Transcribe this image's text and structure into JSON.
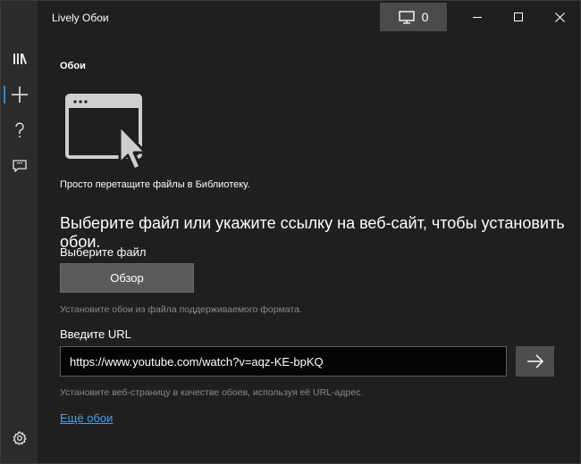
{
  "app": {
    "title": "Lively Обои"
  },
  "titlebar": {
    "monitor_count": "0"
  },
  "sidebar": {
    "items": [
      {
        "name": "library",
        "icon": "library-icon"
      },
      {
        "name": "add",
        "icon": "plus-icon",
        "active": true
      },
      {
        "name": "help",
        "icon": "question-icon"
      },
      {
        "name": "feedback",
        "icon": "feedback-icon"
      }
    ],
    "settings_icon": "gear-icon"
  },
  "main": {
    "section_title": "Обои",
    "drop_hint": "Просто перетащите файлы в Библиотеку.",
    "heading": "Выберите файл или укажите ссылку на веб-сайт, чтобы установить обои.",
    "file": {
      "label": "Выберите файл",
      "button": "Обзор",
      "help": "Установите обои из файла поддерживаемого формата."
    },
    "url": {
      "label": "Введите URL",
      "value": "https://www.youtube.com/watch?v=aqz-KE-bpKQ",
      "help": "Установите веб-страницу в качестве обоев, используя её URL-адрес."
    },
    "more_link": "Ещё обои"
  },
  "colors": {
    "accent": "#2a88d8",
    "link": "#4a9ee8",
    "background": "#1f1f1f",
    "sidebar": "#2b2b2b"
  }
}
